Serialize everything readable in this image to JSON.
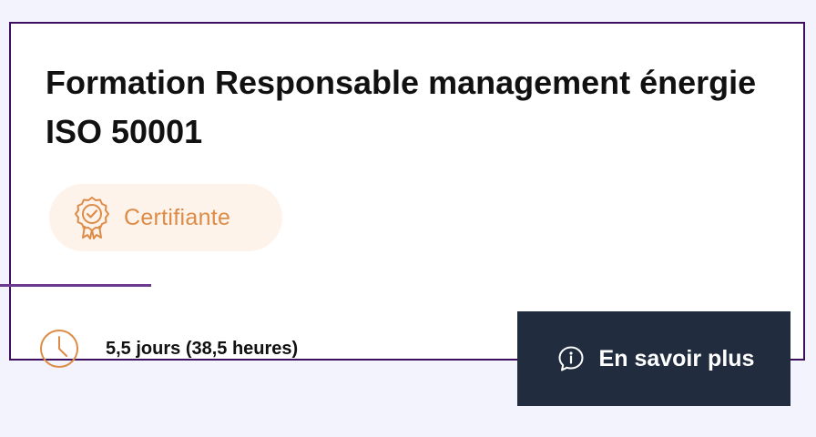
{
  "course": {
    "title": "Formation Responsable management énergie ISO 50001",
    "badge": {
      "label": "Certifiante",
      "icon": "certificate-ribbon-icon",
      "color": "#dd8c47",
      "background": "#fef3ea"
    },
    "duration": {
      "icon": "clock-icon",
      "text": "5,5 jours (38,5 heures)"
    },
    "cta": {
      "label": "En savoir plus",
      "icon": "info-icon",
      "background": "#222c3f"
    }
  },
  "theme": {
    "accent": "#6c3b8f",
    "border": "#3d0f5e",
    "page_background": "#f2f3fc"
  }
}
